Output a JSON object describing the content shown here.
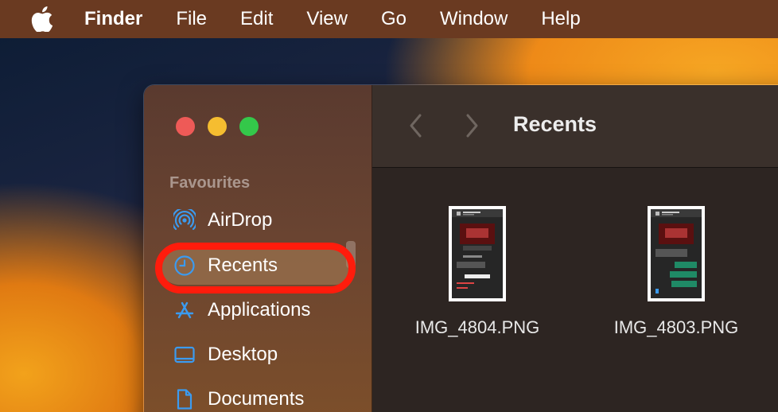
{
  "menubar": {
    "apple_icon": "apple-logo-icon",
    "items": [
      "Finder",
      "File",
      "Edit",
      "View",
      "Go",
      "Window",
      "Help"
    ]
  },
  "sidebar": {
    "section_label": "Favourites",
    "items": [
      {
        "label": "AirDrop",
        "icon": "airdrop-icon"
      },
      {
        "label": "Recents",
        "icon": "clock-icon",
        "selected": true
      },
      {
        "label": "Applications",
        "icon": "applications-icon"
      },
      {
        "label": "Desktop",
        "icon": "desktop-icon"
      },
      {
        "label": "Documents",
        "icon": "document-icon"
      }
    ]
  },
  "toolbar": {
    "title": "Recents",
    "back_icon": "chevron-left-icon",
    "forward_icon": "chevron-right-icon"
  },
  "files": [
    {
      "name": "IMG_4804.PNG"
    },
    {
      "name": "IMG_4803.PNG"
    }
  ],
  "colors": {
    "accent": "#3b9bf0",
    "highlight_ring": "#ff1c0c",
    "close": "#ee5a57",
    "minimize": "#f5bd30",
    "zoom": "#34c84a"
  }
}
